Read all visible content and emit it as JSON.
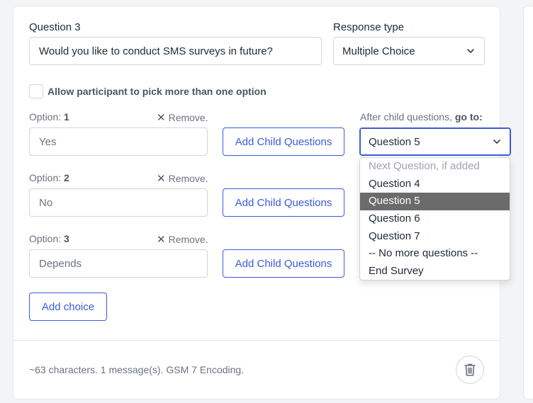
{
  "question": {
    "label": "Question 3",
    "value": "Would you like to conduct SMS surveys in future?"
  },
  "response_type": {
    "label": "Response type",
    "value": "Multiple Choice"
  },
  "multi_pick": {
    "label": "Allow participant to pick more than one option",
    "checked": false
  },
  "goto_label_prefix": "After child questions,",
  "goto_label_bold": "go to:",
  "options": [
    {
      "label": "Option:",
      "number": "1",
      "remove": "Remove.",
      "value": "Yes",
      "child_button": "Add Child Questions"
    },
    {
      "label": "Option:",
      "number": "2",
      "remove": "Remove.",
      "value": "No",
      "child_button": "Add Child Questions"
    },
    {
      "label": "Option:",
      "number": "3",
      "remove": "Remove.",
      "value": "Depends",
      "child_button": "Add Child Questions"
    }
  ],
  "goto_select": {
    "value": "Question 5",
    "options": [
      {
        "label": "Next Question, if added",
        "disabled": true
      },
      {
        "label": "Question 4"
      },
      {
        "label": "Question 5",
        "selected": true
      },
      {
        "label": "Question 6"
      },
      {
        "label": "Question 7"
      },
      {
        "label": "-- No more questions --"
      },
      {
        "label": "End Survey"
      }
    ]
  },
  "add_choice": "Add choice",
  "footer": {
    "info": "~63 characters. 1 message(s). GSM 7 Encoding."
  },
  "colors": {
    "accent": "#3b5bdb",
    "selected_bg": "#6b6b6b"
  },
  "icons": {
    "chevron": "chevron-down-icon",
    "remove": "close-icon",
    "delete": "trash-icon"
  }
}
